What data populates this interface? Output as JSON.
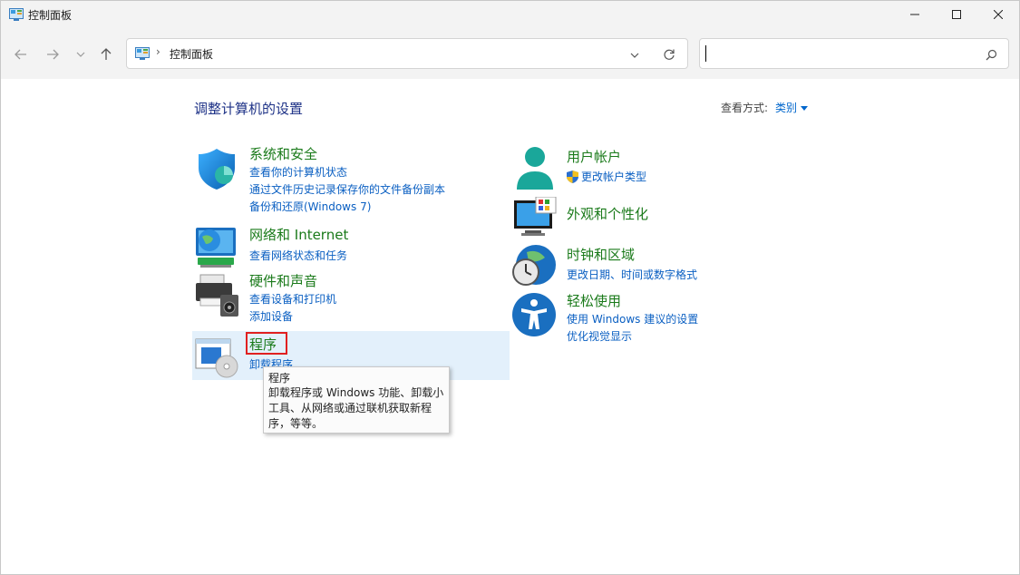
{
  "window": {
    "title": "控制面板"
  },
  "nav": {
    "breadcrumb": "控制面板",
    "search_value": ""
  },
  "main": {
    "heading": "调整计算机的设置",
    "view_by_label": "查看方式:",
    "view_by_value": "类别"
  },
  "categories": {
    "system": {
      "title": "系统和安全",
      "links": [
        "查看你的计算机状态",
        "通过文件历史记录保存你的文件备份副本",
        "备份和还原(Windows 7)"
      ]
    },
    "network": {
      "title": "网络和 Internet",
      "links": [
        "查看网络状态和任务"
      ]
    },
    "hardware": {
      "title": "硬件和声音",
      "links": [
        "查看设备和打印机",
        "添加设备"
      ]
    },
    "programs": {
      "title": "程序",
      "links": [
        "卸载程序"
      ]
    },
    "user": {
      "title": "用户帐户",
      "links": [
        "更改帐户类型"
      ]
    },
    "appearance": {
      "title": "外观和个性化",
      "links": []
    },
    "clock": {
      "title": "时钟和区域",
      "links": [
        "更改日期、时间或数字格式"
      ]
    },
    "ease": {
      "title": "轻松使用",
      "links": [
        "使用 Windows 建议的设置",
        "优化视觉显示"
      ]
    }
  },
  "tooltip": {
    "title": "程序",
    "body": "卸载程序或 Windows 功能、卸载小工具、从网络或通过联机获取新程序，等等。"
  },
  "colors": {
    "category_title": "#1a7a1a",
    "link": "#0a5fc2",
    "heading": "#1e3287",
    "hover_bg": "#e3f0fb",
    "focus_border": "#e02020"
  }
}
